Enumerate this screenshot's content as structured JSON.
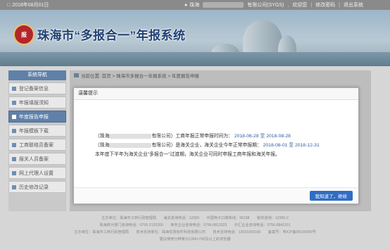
{
  "topbar": {
    "date": "2018年08月01日",
    "user_prefix": "珠海",
    "company_suffix": "有限公司(SYGS)",
    "welcome": "欢迎您",
    "change_password": "修改密码",
    "logout": "退出系统"
  },
  "banner": {
    "logo_text": "报",
    "title": "珠海市“多报合一”年报系统"
  },
  "sidebar": {
    "header": "系统导航",
    "items": [
      {
        "label": "登记备案信息"
      },
      {
        "label": "年报填报须知"
      },
      {
        "label": "年度报告申报"
      },
      {
        "label": "年报模板下载"
      },
      {
        "label": "工商联络员备案"
      },
      {
        "label": "报关人员备案"
      },
      {
        "label": "网上代理人设置"
      },
      {
        "label": "历史修改记录"
      }
    ],
    "active_index": 2
  },
  "breadcrumb": {
    "text": "当前位置: 首页 > 珠海市多报合一年报系统 > 年度报告申报"
  },
  "modal": {
    "title": "温馨提示",
    "line1_prefix": "（珠海",
    "line1_mid": "有限公司）工商年报正常申报时间为：",
    "line1_start": "2018-06-28",
    "line1_to": "至",
    "line1_end": "2018-08-28",
    "line2_prefix": "（珠海",
    "line2_mid": "有限公司）是海关企业，海关企业今年正常申报期：",
    "line2_start": "2018-08-01",
    "line2_to": "至",
    "line2_end": "2018-12-31",
    "line3": "本年度下半年为海关企业”多报合一”过渡期，海关企业可同时申报工商年报和海关年报。",
    "ok_button": "我知道了，继续"
  },
  "footer": {
    "row1": "主办单位：珠海市工商行政管理局　　海关咨询电话：12360　　中国电子口岸热线：96198　　税务咨询：12366-2",
    "row2": "珠海统计部门咨询电话：0756-2120266　　商务企业咨询电话：0756-8813323　　外汇企业咨询电话：0756-8841101",
    "row3": "主办单位：珠海市工商行政管理局　　技术支持单位：珠海优扬软件科技有限公司　　技术支持电话：13631669166　　备案号：粤ICP备05026960号",
    "row4": "建议使用分辨率为1366×768及以上的浏览器"
  }
}
